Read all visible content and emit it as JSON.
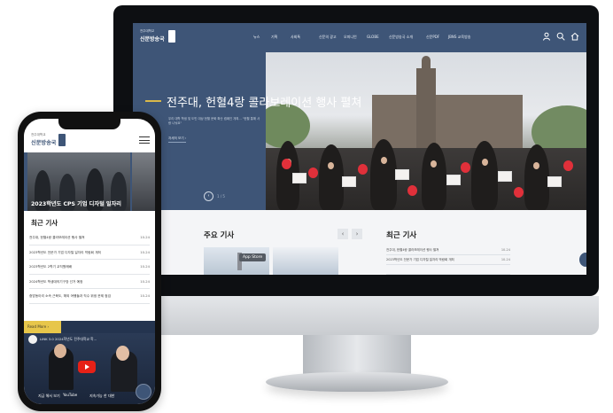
{
  "desktop": {
    "logo": {
      "line1": "전주대학교",
      "line2": "신문방송국"
    },
    "nav": [
      "뉴스",
      "기획",
      "사회톡",
      "신문의 광고",
      "오피니언",
      "GLOBE",
      "신문방송국 소개",
      "신문PDF",
      "JBNS 교육방송"
    ],
    "header_icons": [
      "user-icon",
      "search-icon",
      "home-icon"
    ],
    "hero": {
      "title": "전주대, 헌혈4랑 콜라보레이션 행사 펼쳐",
      "subtitle": "우리 대학 학생 및 도민 대상 헌혈 문화 확산 캠페인 개최… \"헌혈 통해 사랑 나눠요\"",
      "more": "자세히 보기 ›",
      "pager_prev": "‹",
      "pager_text": "1 / 5"
    },
    "main_articles": {
      "heading": "주요 기사",
      "prev": "‹",
      "next": "›",
      "badge": "App Store"
    },
    "recent_articles": {
      "heading": "최근 기사",
      "items": [
        {
          "title": "전주대, 헌혈4랑 콜라보레이션 행사 펼쳐",
          "date": "10-24"
        },
        {
          "title": "2023학년도 전문가 기업 디자털 일자리 박람회 개최",
          "date": "10-24"
        },
        {
          "title": "",
          "date": ""
        }
      ]
    }
  },
  "mobile": {
    "logo": {
      "line1": "전주대학교",
      "line2": "신문방송국"
    },
    "hero": {
      "title": "2023학년도 CPS 기업 디자털 일자리"
    },
    "recent": {
      "heading": "최근 기사",
      "items": [
        {
          "title": "전주대, 헌혈4랑 콜라보레이션 행사 펼쳐",
          "date": "10-24"
        },
        {
          "title": "2023학년도 전문가 기업 디자털 일자리 박람회 개최",
          "date": "10-24"
        },
        {
          "title": "2023학년도 2학기 교직원예배",
          "date": "10-24"
        },
        {
          "title": "2024학년도 학생대의기구장 선거 예정",
          "date": "10-24"
        },
        {
          "title": "중앙동아리 소속 근육도, 해외 여행들과 직수 위생 문제 점검",
          "date": "10-24"
        }
      ]
    },
    "banner": "Read More ›",
    "video": {
      "title": "LINK 3.0 2024학년도 전주대학교 학...",
      "caption_left": "지금 해서 보기",
      "platform": "YouTube",
      "caption_right": "지속가능 한 대한"
    }
  }
}
